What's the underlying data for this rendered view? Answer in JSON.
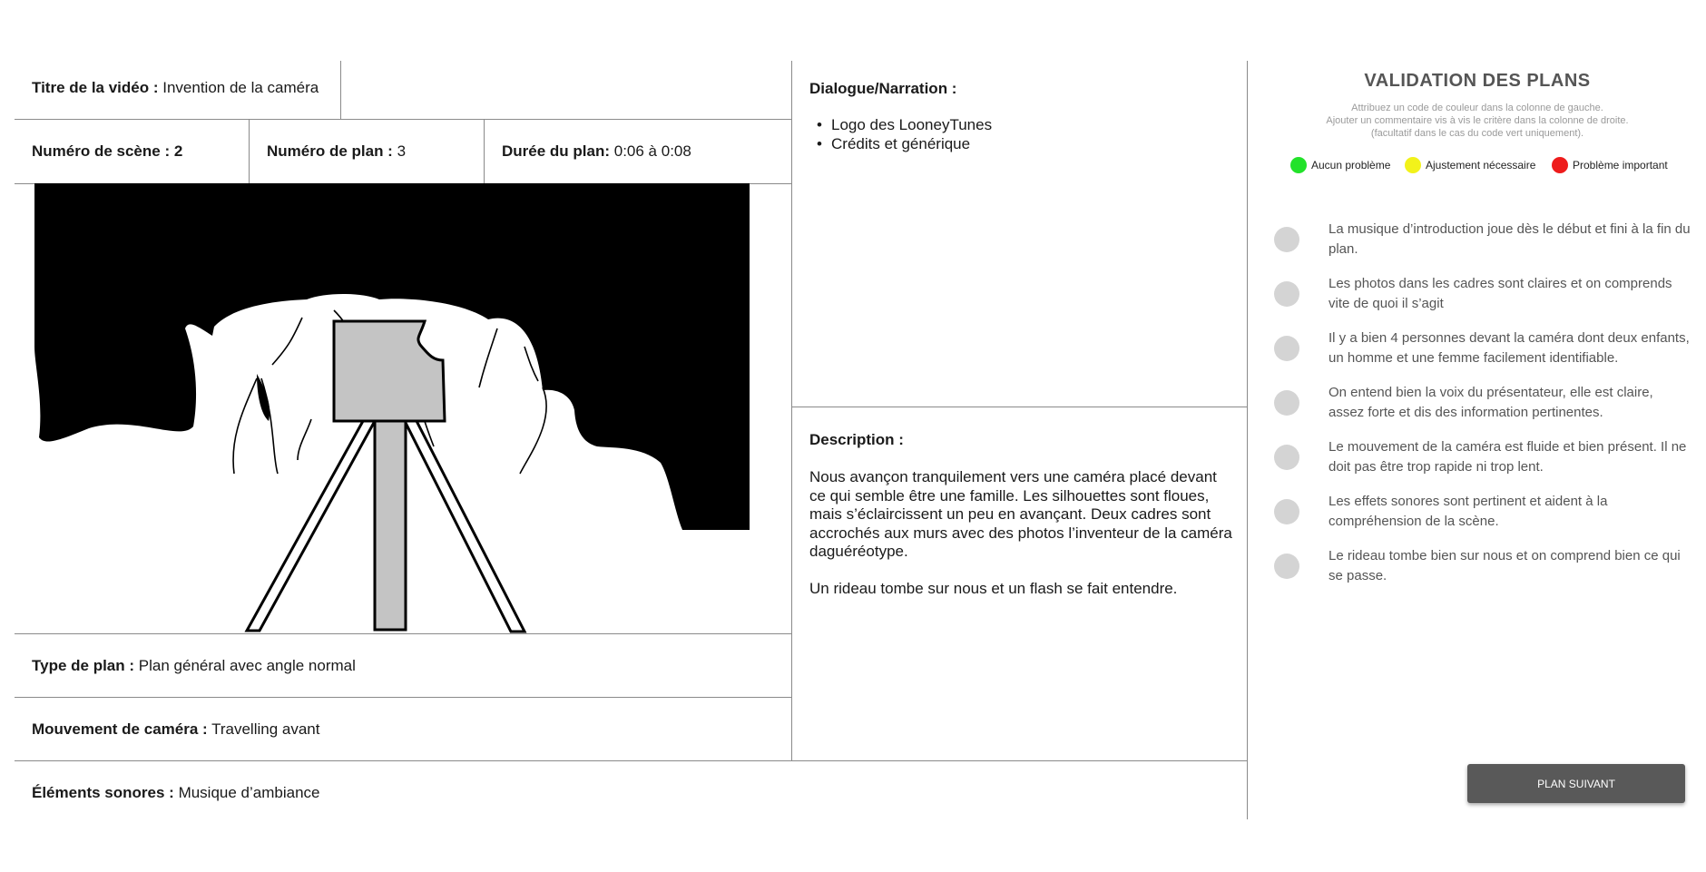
{
  "video": {
    "title_label": "Titre de la vidéo :",
    "title_value": "Invention de la caméra"
  },
  "scene": {
    "label": "Numéro de scène :",
    "value": "2"
  },
  "plan_number": {
    "label": "Numéro de plan :",
    "value": "3"
  },
  "duration": {
    "label": "Durée du plan:",
    "value": "0:06 à 0:08"
  },
  "shot_type": {
    "label": "Type de plan :",
    "value": "Plan général avec angle normal"
  },
  "camera_movement": {
    "label": "Mouvement de caméra :",
    "value": "Travelling avant"
  },
  "sound_elements": {
    "label": "Éléments sonores :",
    "value": "Musique d’ambiance"
  },
  "dialogue": {
    "label": "Dialogue/Narration :",
    "items": [
      "Logo des LooneyTunes",
      "Crédits et générique"
    ]
  },
  "description": {
    "label": "Description :",
    "paragraphs": [
      "Nous avançon tranquilement vers une caméra placé devant ce qui semble être une famille. Les silhouettes sont floues, mais s’éclaircissent un peu en avançant. Deux cadres sont accrochés aux murs avec des photos l’inventeur de la caméra daguéréotype.",
      "Un rideau tombe sur nous et un flash se fait entendre."
    ]
  },
  "validation": {
    "title": "VALIDATION DES PLANS",
    "subtitle_lines": [
      "Attribuez un code de couleur dans la colonne de gauche.",
      "Ajouter un commentaire vis à vis le critère dans la colonne de droite.",
      "(facultatif dans le cas du code vert uniquement)."
    ],
    "legend": [
      {
        "label": "Aucun problème",
        "color": "#22e22a"
      },
      {
        "label": "Ajustement nécessaire",
        "color": "#f2f21a"
      },
      {
        "label": "Problème important",
        "color": "#ee1c1c"
      }
    ],
    "criteria": [
      "La musique d’introduction joue dès le début et fini à la fin du plan.",
      "Les photos dans les cadres sont claires et on comprends vite de quoi il s’agit",
      "Il y a bien 4 personnes devant la caméra dont deux enfants, un homme et une femme facilement identifiable.",
      "On entend bien la voix du présentateur, elle est claire, assez forte et dis des information pertinentes.",
      "Le mouvement de la caméra est fluide et bien présent. Il ne doit pas être trop rapide ni trop lent.",
      "Les effets sonores sont pertinent et aident à la compréhension de la scène.",
      "Le rideau tombe bien sur nous et on comprend bien ce qui se passe."
    ],
    "criterion_status_color": "#d4d4d4",
    "next_button_label": "PLAN SUIVANT"
  },
  "colors": {
    "button_bg": "#595959",
    "panel_title": "#555555",
    "grid_lines": "#8a8a8a"
  }
}
